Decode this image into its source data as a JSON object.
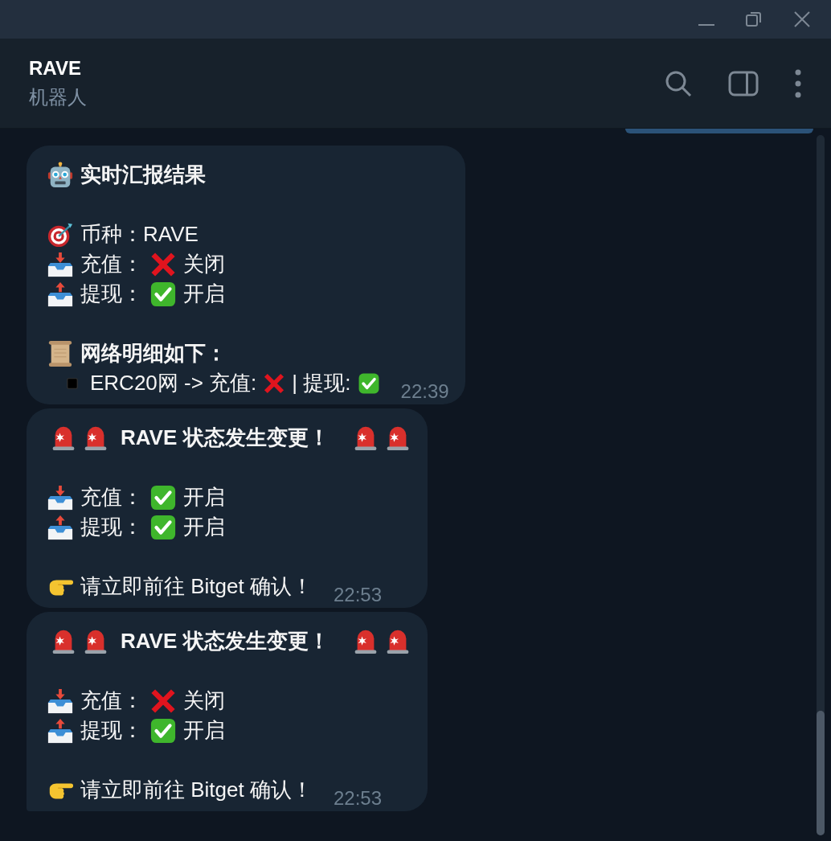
{
  "window": {
    "title": "RAVE",
    "subtitle": "机器人"
  },
  "messages": [
    {
      "time": "22:39",
      "lines": [
        {
          "kind": "report-title",
          "text": "实时汇报结果"
        },
        {
          "kind": "blank"
        },
        {
          "kind": "coin",
          "text": "币种：RAVE"
        },
        {
          "kind": "deposit",
          "label": "充值：",
          "on": false,
          "status": "关闭"
        },
        {
          "kind": "withdraw",
          "label": "提现：",
          "on": true,
          "status": "开启"
        },
        {
          "kind": "blank"
        },
        {
          "kind": "network-title",
          "text": "网络明细如下："
        },
        {
          "kind": "network",
          "text": "ERC20网 -> 充值:",
          "deposit_on": false,
          "separator": "| 提现:",
          "withdraw_on": true
        }
      ]
    },
    {
      "time": "22:53",
      "lines": [
        {
          "kind": "alert-title",
          "text": "RAVE 状态发生变更！"
        },
        {
          "kind": "blank"
        },
        {
          "kind": "deposit",
          "label": "充值：",
          "on": true,
          "status": "开启"
        },
        {
          "kind": "withdraw",
          "label": "提现：",
          "on": true,
          "status": "开启"
        },
        {
          "kind": "blank"
        },
        {
          "kind": "note",
          "text": "请立即前往 Bitget 确认！"
        }
      ]
    },
    {
      "time": "22:53",
      "lines": [
        {
          "kind": "alert-title",
          "text": "RAVE 状态发生变更！"
        },
        {
          "kind": "blank"
        },
        {
          "kind": "deposit",
          "label": "充值：",
          "on": false,
          "status": "关闭"
        },
        {
          "kind": "withdraw",
          "label": "提现：",
          "on": true,
          "status": "开启"
        },
        {
          "kind": "blank"
        },
        {
          "kind": "note",
          "text": "请立即前往 Bitget 确认！"
        }
      ]
    }
  ]
}
